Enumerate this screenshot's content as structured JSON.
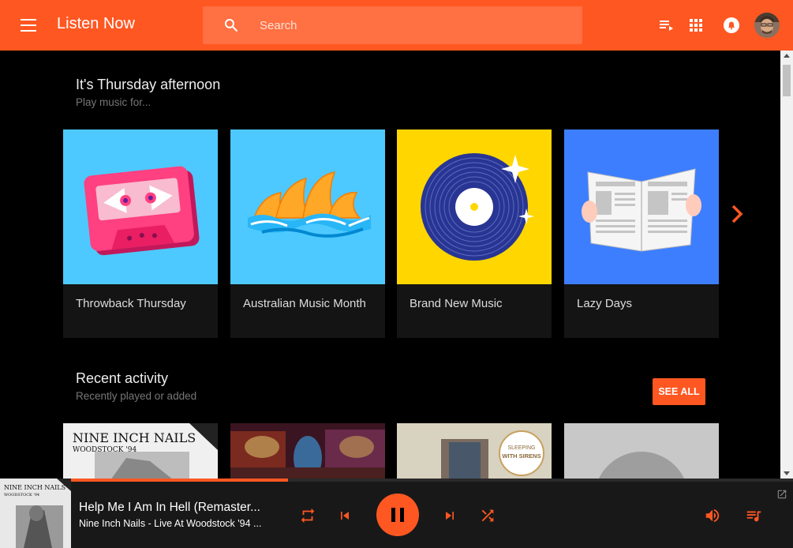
{
  "header": {
    "title": "Listen Now",
    "search_placeholder": "Search"
  },
  "icons": {
    "menu": "menu-icon",
    "search": "search-icon",
    "queue": "queue-icon",
    "apps": "apps-grid-icon",
    "notifications": "bell-icon",
    "next": "chevron-right-icon"
  },
  "colors": {
    "accent": "#ff5722",
    "search_bg": "#ff7043",
    "background": "#000000",
    "card_bg": "#141414"
  },
  "section1": {
    "title": "It's Thursday afternoon",
    "subtitle": "Play music for..."
  },
  "cards": [
    {
      "label": "Throwback Thursday",
      "color": "#4dc9ff",
      "art": "cassette"
    },
    {
      "label": "Australian Music Month",
      "color": "#4dc9ff",
      "art": "opera-house"
    },
    {
      "label": "Brand New Music",
      "color": "#ffd600",
      "art": "vinyl-record"
    },
    {
      "label": "Lazy Days",
      "color": "#3d7eff",
      "art": "newspaper"
    }
  ],
  "section2": {
    "title": "Recent activity",
    "subtitle": "Recently played or added",
    "see_all": "SEE ALL"
  },
  "recent": [
    {
      "art": "nine-inch-nails-woodstock-94",
      "text_line1": "NINE INCH NAILS",
      "text_line2": "WOODSTOCK '94"
    },
    {
      "art": "colorful-album-art"
    },
    {
      "art": "sleeping-with-sirens",
      "text_line1": "SLEEPING",
      "text_line2": "WITH SIRENS"
    },
    {
      "art": "grey-album-art"
    }
  ],
  "player": {
    "track_title": "Help Me I Am In Hell (Remaster...",
    "track_subtitle": "Nine Inch Nails - Live At Woodstock '94 ...",
    "progress": 0.3,
    "art_text1": "NINE INCH NAILS",
    "art_text2": "WOODSTOCK '94"
  }
}
